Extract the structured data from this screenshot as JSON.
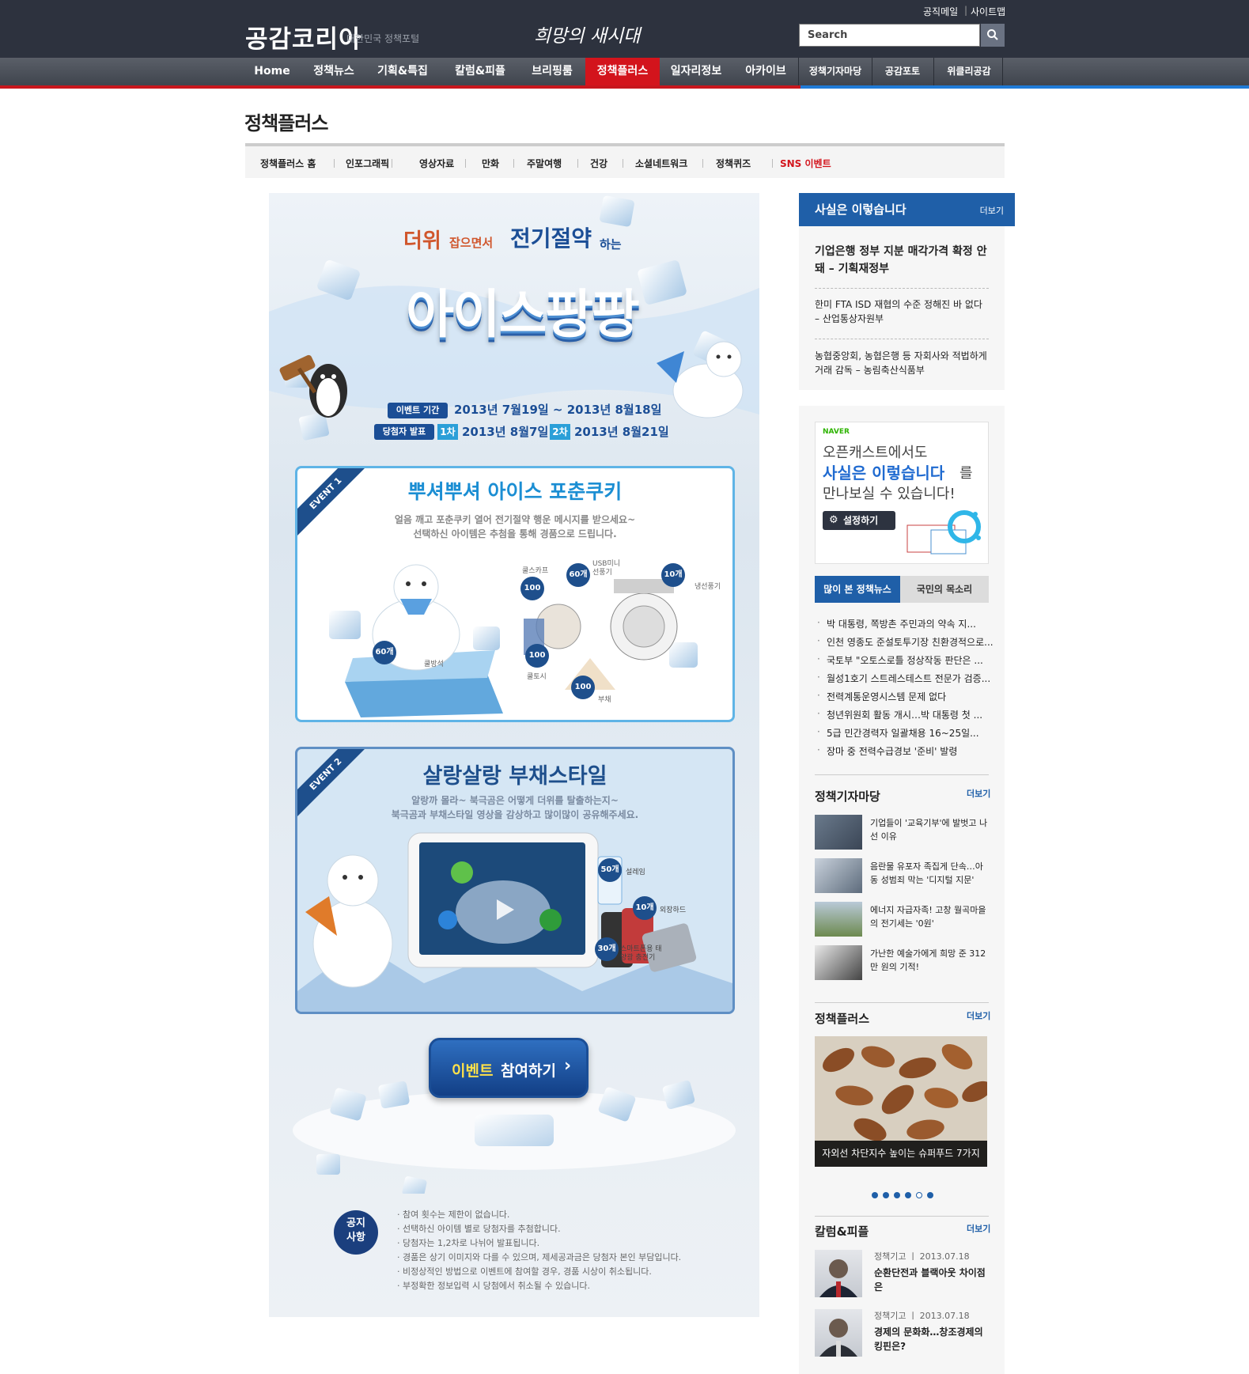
{
  "header": {
    "logo": "공감코리아",
    "logo_sub": "대한민국 정책포털",
    "slogan": "희망의 새시대",
    "util_links": [
      "공직메일",
      "사이트맵"
    ],
    "search_placeholder": "Search"
  },
  "nav": {
    "main": [
      "Home",
      "정책뉴스",
      "기획&특집",
      "칼럼&피플",
      "브리핑룸",
      "정책플러스",
      "일자리정보",
      "아카이브"
    ],
    "extra": [
      "정책기자마당",
      "공감포토",
      "위클리공감"
    ]
  },
  "page_title": "정책플러스",
  "subnav": [
    "정책플러스 홈",
    "인포그래픽",
    "영상자료",
    "만화",
    "주말여행",
    "건강",
    "소셜네트워크",
    "정책퀴즈",
    "SNS 이벤트"
  ],
  "banner": {
    "headline_part1": "더위",
    "headline_part2": "잡으면서",
    "headline_part3": "전기절약",
    "headline_part4": "하는",
    "title": "아이스팡팡",
    "period_label": "이벤트 기간",
    "period": "2013년 7월19일 ~ 2013년 8월18일",
    "winner_label": "당첨자 발표",
    "round1_label": "1차",
    "round1": "2013년 8월7일",
    "round2_label": "2차",
    "round2": "2013년 8월21일",
    "event1": {
      "tag": "EVENT 1",
      "title": "뿌셔뿌셔 아이스 포춘쿠키",
      "desc1": "얼음 깨고 포춘쿠키 열어 전기절약 행운 메시지를 받으세요~",
      "desc2": "선택하신 아이템은 추첨을 통해 경품으로 드립니다.",
      "prizes": [
        {
          "count": "60개",
          "name": "쿨방석"
        },
        {
          "count": "100개",
          "name": "쿨스카프"
        },
        {
          "count": "60개",
          "name": "USB미니 선풍기"
        },
        {
          "count": "10개",
          "name": "냉선풍기"
        },
        {
          "count": "100개",
          "name": "쿨토시"
        },
        {
          "count": "100개",
          "name": "부채"
        }
      ]
    },
    "event2": {
      "tag": "EVENT 2",
      "title": "살랑살랑 부채스타일",
      "desc1": "알랑까 몰라~ 북극곰은 어떻게 더위를 탈출하는지~",
      "desc2": "북극곰과 부채스타일 영상을 감상하고 많이많이 공유해주세요.",
      "prizes": [
        {
          "count": "50개",
          "name": "설레임"
        },
        {
          "count": "10개",
          "name": "외장하드"
        },
        {
          "count": "30개",
          "name": "스마트폰용 태양광 충전기"
        }
      ]
    },
    "cta_highlight": "이벤트",
    "cta_rest": "참여하기",
    "notice_label": "공지 사항",
    "notices": [
      "참여 횟수는 제한이 없습니다.",
      "선택하신 아이템 별로 당첨자를 추첨합니다.",
      "당첨자는 1,2차로 나뉘어 발표됩니다.",
      "경품은 상기 이미지와 다를 수 있으며, 제세공과금은 당첨자 본인 부담입니다.",
      "비정상적인 방법으로 이벤트에 참여할 경우, 경품 시상이 취소됩니다.",
      "부정확한 정보입력 시 당첨에서 취소될 수 있습니다."
    ]
  },
  "facts": {
    "title": "사실은 이렇습니다",
    "more": "더보기",
    "items": [
      "기업은행 정부 지분 매각가격 확정 안돼 – 기획재정부",
      "한미 FTA ISD 재협의 수준 정해진 바 없다 – 산업통상자원부",
      "농협중앙회, 농협은행 등 자회사와 적법하게 거래 감독 – 농림축산식품부"
    ]
  },
  "naver_ad": {
    "brand": "NAVER",
    "line1": "오픈캐스트에서도",
    "highlight": "사실은 이렇습니다",
    "line2_suffix": "를",
    "line3": "만나보실 수 있습니다!",
    "button": "설정하기"
  },
  "news_tabs": [
    "많이 본 정책뉴스",
    "국민의 목소리"
  ],
  "popular_news": [
    "박 대통령, 쪽방촌 주민과의 약속 지...",
    "인천 영종도 준설토투기장 친환경적으로...",
    "국토부 \"오토스로틀 정상작동 판단은 ...",
    "월성1호기 스트레스테스트 전문가 검증...",
    "전력계통운영시스템 문제 없다",
    "청년위원회 활동 개시…박 대통령 첫 ...",
    "5급 민간경력자 일괄채용 16~25일...",
    "장마 중 전력수급경보 '준비' 발령"
  ],
  "reporter": {
    "title": "정책기자마당",
    "more": "더보기",
    "items": [
      "기업들이 '교육기부'에 발벗고 나선 이유",
      "음란물 유포자 족집게 단속…아동 성범죄 막는 '디지털 지문'",
      "에너지 자급자족! 고창 월곡마을의 전기세는 '0원'",
      "가난한 예술가에게 희망 준 312만 원의 기적!"
    ]
  },
  "plus": {
    "title": "정책플러스",
    "more": "더보기",
    "caption": "자외선 차단지수 높이는 슈퍼푸드 7가지"
  },
  "column": {
    "title": "칼럼&피플",
    "more": "더보기",
    "items": [
      {
        "meta": "정책기고 ㅣ 2013.07.18",
        "title": "순환단전과 블랙아웃 차이점은"
      },
      {
        "meta": "정책기고 ㅣ 2013.07.18",
        "title": "경제의 문화화…창조경제의 킹핀은?"
      }
    ]
  }
}
